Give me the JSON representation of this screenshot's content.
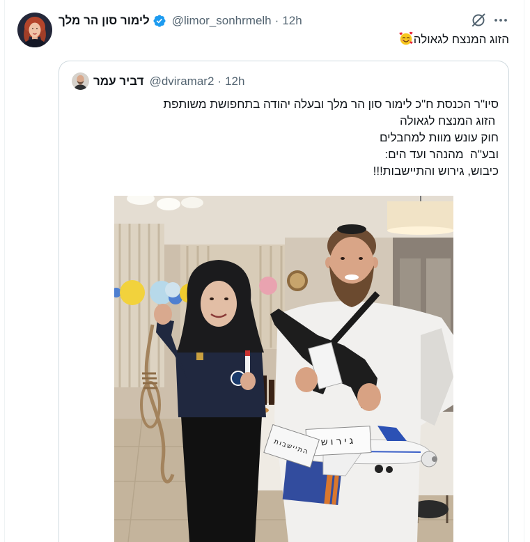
{
  "tweet": {
    "author": {
      "name": "לימור סון הר מלך",
      "handle": "@limor_sonhrmelh",
      "verified": true
    },
    "separator": "·",
    "time": "12h",
    "text": "הזוג המנצח לגאולה",
    "emoji": "smiling-face-with-hearts-emoji",
    "icons": {
      "verified": "verified-badge-icon",
      "grok": "grok-icon",
      "more": "more-icon"
    }
  },
  "quote": {
    "author": {
      "name": "דביר עמר",
      "handle": "@dviramar2"
    },
    "separator": "·",
    "time": "12h",
    "lines": [
      "סיו\"ר הכנסת ח\"כ לימור סון הר מלך ובעלה יהודה בתחפושת משותפת",
      " הזוג המנצח לגאולה",
      "חוק עונש מוות למחבלים",
      "ובע\"ה  מהנהר ועד הים:",
      "כיבוש, גירוש והתיישבות!!!"
    ],
    "photo": {
      "signs": [
        "גירוש",
        "התיישבות"
      ]
    }
  },
  "colors": {
    "text": "#0f1419",
    "secondary_text": "#536471",
    "verified_badge": "#1d9bf0",
    "quote_border": "#cfd9de",
    "divider": "#eff3f4",
    "background": "#ffffff"
  }
}
